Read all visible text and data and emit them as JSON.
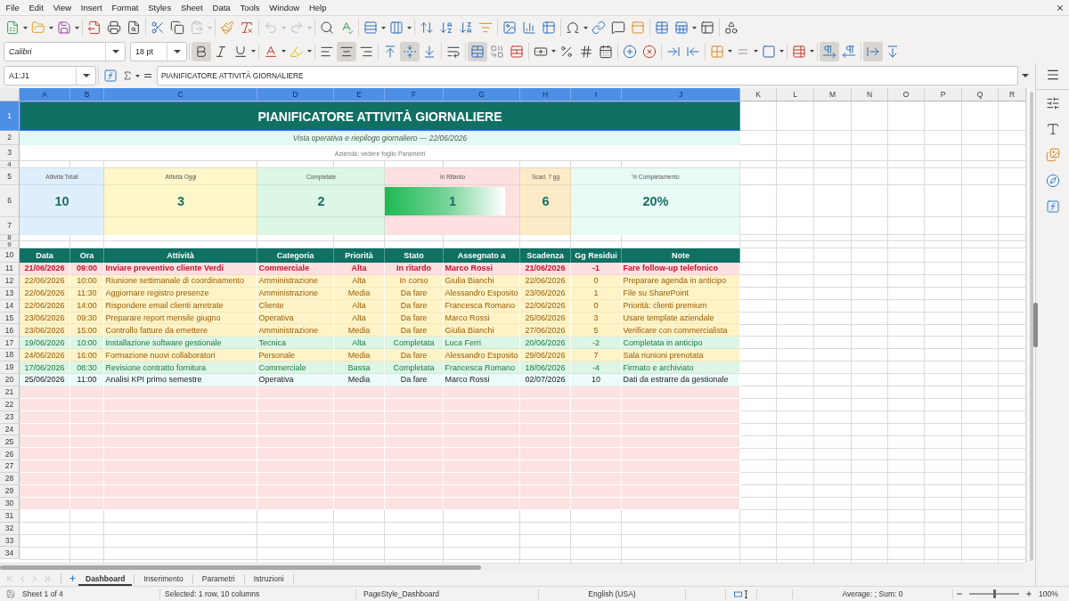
{
  "menu": [
    "File",
    "Edit",
    "View",
    "Insert",
    "Format",
    "Styles",
    "Sheet",
    "Data",
    "Tools",
    "Window",
    "Help"
  ],
  "standard_toolbar": {
    "paste_enabled": false,
    "undo_enabled": false,
    "redo_enabled": false
  },
  "formatting": {
    "font_name": "Calibri",
    "font_size": "18 pt",
    "bold": true,
    "italic": false,
    "underline": false,
    "align_left": false,
    "align_center": true,
    "align_right": false,
    "align_top": false,
    "align_middle": true,
    "align_bottom": false,
    "merge_and_center": true,
    "left_to_right": true,
    "right_to_left": false,
    "text_horizontal": true,
    "text_vertical": false
  },
  "formula_bar": {
    "name_box": "A1:J1",
    "content": "PIANIFICATORE ATTIVITÀ GIORNALIERE"
  },
  "column_headers": [
    {
      "label": "A",
      "selected": true
    },
    {
      "label": "B",
      "selected": true
    },
    {
      "label": "C",
      "selected": true
    },
    {
      "label": "D",
      "selected": true
    },
    {
      "label": "E",
      "selected": true
    },
    {
      "label": "F",
      "selected": true
    },
    {
      "label": "G",
      "selected": true
    },
    {
      "label": "H",
      "selected": true
    },
    {
      "label": "I",
      "selected": true
    },
    {
      "label": "J",
      "selected": true
    },
    {
      "label": "K",
      "selected": false
    },
    {
      "label": "L",
      "selected": false
    },
    {
      "label": "M",
      "selected": false
    },
    {
      "label": "N",
      "selected": false
    },
    {
      "label": "O",
      "selected": false
    },
    {
      "label": "P",
      "selected": false
    },
    {
      "label": "Q",
      "selected": false
    },
    {
      "label": "R",
      "selected": false
    }
  ],
  "row_headers": [
    {
      "label": "1",
      "selected": true
    },
    {
      "label": "2",
      "selected": false
    },
    {
      "label": "3",
      "selected": false
    },
    {
      "label": "4",
      "selected": false
    },
    {
      "label": "5",
      "selected": false
    },
    {
      "label": "6",
      "selected": false
    },
    {
      "label": "7",
      "selected": false
    },
    {
      "label": "8",
      "selected": false
    },
    {
      "label": "9",
      "selected": false
    },
    {
      "label": "10",
      "selected": false
    },
    {
      "label": "11",
      "selected": false
    },
    {
      "label": "12",
      "selected": false
    },
    {
      "label": "13",
      "selected": false
    },
    {
      "label": "14",
      "selected": false
    },
    {
      "label": "15",
      "selected": false
    },
    {
      "label": "16",
      "selected": false
    },
    {
      "label": "17",
      "selected": false
    },
    {
      "label": "18",
      "selected": false
    },
    {
      "label": "19",
      "selected": false
    },
    {
      "label": "20",
      "selected": false
    },
    {
      "label": "21",
      "selected": false
    },
    {
      "label": "22",
      "selected": false
    },
    {
      "label": "23",
      "selected": false
    },
    {
      "label": "24",
      "selected": false
    },
    {
      "label": "25",
      "selected": false
    },
    {
      "label": "26",
      "selected": false
    },
    {
      "label": "27",
      "selected": false
    },
    {
      "label": "28",
      "selected": false
    },
    {
      "label": "29",
      "selected": false
    },
    {
      "label": "30",
      "selected": false
    },
    {
      "label": "31",
      "selected": false
    },
    {
      "label": "32",
      "selected": false
    },
    {
      "label": "33",
      "selected": false
    },
    {
      "label": "34",
      "selected": false
    }
  ],
  "sheet": {
    "title": {
      "text": "PIANIFICATORE ATTIVITÀ GIORNALIERE",
      "selected": true
    },
    "subtitle": "Vista operativa e riepilogo giornaliero — 22/06/2026",
    "note": "Azienda: vedere foglio Parametri",
    "kpis": [
      {
        "label": "Attività Totali",
        "value": "10",
        "color": "#dfeefd"
      },
      {
        "label": "Attività Oggi",
        "value": "3",
        "color": "#fff6c9"
      },
      {
        "label": "Completate",
        "value": "2",
        "color": "#ddf7e6"
      },
      {
        "label": "In Ritardo",
        "value": "1",
        "color": "#fde1e1",
        "level": 0.89
      },
      {
        "label": "Scad. 7 gg",
        "value": "6",
        "color": "#fdebc7"
      },
      {
        "label": "% Completamento",
        "value": "20%",
        "color": "#e8fbf6"
      }
    ],
    "table": {
      "columns": [
        "Data",
        "Ora",
        "Attività",
        "Categoria",
        "Priorità",
        "Stato",
        "Assegnato a",
        "Scadenza",
        "Gg Residui",
        "Note"
      ],
      "rows": [
        {
          "kind": "overdue",
          "cells": [
            "21/06/2026",
            "09:00",
            "Inviare preventivo cliente Verdi",
            "Commerciale",
            "Alta",
            "In ritardo",
            "Marco Rossi",
            "21/06/2026",
            "-1",
            "Fare follow-up telefonico"
          ]
        },
        {
          "kind": "pending",
          "cells": [
            "22/06/2026",
            "10:00",
            "Riunione settimanale di coordinamento",
            "Amministrazione",
            "Alta",
            "In corso",
            "Giulia Bianchi",
            "22/06/2026",
            "0",
            "Preparare agenda in anticipo"
          ]
        },
        {
          "kind": "pending",
          "cells": [
            "22/06/2026",
            "11:30",
            "Aggiornare registro presenze",
            "Amministrazione",
            "Media",
            "Da fare",
            "Alessandro Esposito",
            "23/06/2026",
            "1",
            "File su SharePoint"
          ]
        },
        {
          "kind": "pending",
          "cells": [
            "22/06/2026",
            "14:00",
            "Rispondere email clienti arretrate",
            "Cliente",
            "Alta",
            "Da fare",
            "Francesca Romano",
            "22/06/2026",
            "0",
            "Priorità: clienti premium"
          ]
        },
        {
          "kind": "pending",
          "cells": [
            "23/06/2026",
            "09:30",
            "Preparare report mensile giugno",
            "Operativa",
            "Alta",
            "Da fare",
            "Marco Rossi",
            "25/06/2026",
            "3",
            "Usare template aziendale"
          ]
        },
        {
          "kind": "pending",
          "cells": [
            "23/06/2026",
            "15:00",
            "Controllo fatture da emettere",
            "Amministrazione",
            "Media",
            "Da fare",
            "Giulia Bianchi",
            "27/06/2026",
            "5",
            "Verificare con commercialista"
          ]
        },
        {
          "kind": "done",
          "cells": [
            "19/06/2026",
            "10:00",
            "Installazione software gestionale",
            "Tecnica",
            "Alta",
            "Completata",
            "Luca Ferri",
            "20/06/2026",
            "-2",
            "Completata in anticipo"
          ]
        },
        {
          "kind": "pending",
          "cells": [
            "24/06/2026",
            "16:00",
            "Formazione nuovi collaboratori",
            "Personale",
            "Media",
            "Da fare",
            "Alessandro Esposito",
            "29/06/2026",
            "7",
            "Sala riunioni prenotata"
          ]
        },
        {
          "kind": "done",
          "cells": [
            "17/06/2026",
            "08:30",
            "Revisione contratto fornitura",
            "Commerciale",
            "Bassa",
            "Completata",
            "Francesca Romano",
            "18/06/2026",
            "-4",
            "Firmato e archiviato"
          ]
        },
        {
          "kind": "upcoming",
          "cells": [
            "25/06/2026",
            "11:00",
            "Analisi KPI primo semestre",
            "Operativa",
            "Media",
            "Da fare",
            "Marco Rossi",
            "02/07/2026",
            "10",
            "Dati da estrarre da gestionale"
          ]
        }
      ]
    }
  },
  "sheet_tabs": [
    {
      "label": "Dashboard",
      "selected": true
    },
    {
      "label": "Inserimento",
      "selected": false
    },
    {
      "label": "Parametri",
      "selected": false
    },
    {
      "label": "Istruzioni",
      "selected": false
    }
  ],
  "status_bar": {
    "sheet": "Sheet 1 of 4",
    "selection": "Selected: 1 row, 10 columns",
    "page_style": "PageStyle_Dashboard",
    "language": "English (USA)",
    "summary": "Average: ; Sum: 0",
    "zoom": {
      "level": 0.5,
      "reading": "100%"
    }
  }
}
